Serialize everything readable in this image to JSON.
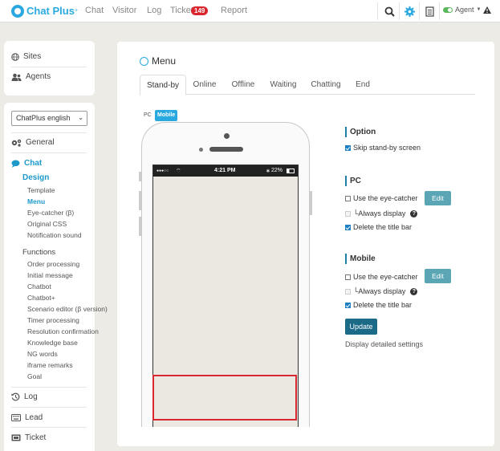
{
  "app": {
    "logo_text": "Chat Plus",
    "logo_sup": "+"
  },
  "topnav": {
    "items": [
      "Chat",
      "Visitor",
      "Log",
      "Ticket",
      "Report"
    ],
    "ticket_badge": "149",
    "agent_label": "Agent"
  },
  "sidebar": {
    "top_items": [
      "Sites",
      "Agents"
    ],
    "site_select": "ChatPlus english",
    "general": "General",
    "chat": "Chat",
    "design_header": "Design",
    "design_items": [
      "Template",
      "Menu",
      "Eye-catcher (β)",
      "Original CSS",
      "Notification sound"
    ],
    "functions_header": "Functions",
    "function_items": [
      "Order processing",
      "Initial message",
      "Chatbot",
      "Chatbot+",
      "Scenario editor (β version)",
      "Timer processing",
      "Resolution confirmation",
      "Knowledge base",
      "NG words",
      "iframe remarks",
      "Goal"
    ],
    "bottom_items": [
      "Log",
      "Lead",
      "Ticket"
    ]
  },
  "main": {
    "title": "Menu",
    "tabs": [
      "Stand-by",
      "Online",
      "Offline",
      "Waiting",
      "Chatting",
      "End"
    ],
    "active_tab": "Stand-by",
    "device_tabs": [
      "PC",
      "Mobile"
    ],
    "phone_status": {
      "left": "●●●○○",
      "time": "4:21 PM",
      "battery": "22%"
    }
  },
  "settings": {
    "option_header": "Option",
    "skip_standby": "Skip stand-by screen",
    "pc_header": "PC",
    "mobile_header": "Mobile",
    "use_eye_catcher": "Use the eye-catcher",
    "edit_label": "Edit",
    "always_display": "└Always display",
    "delete_title_bar": "Delete the title bar",
    "update_label": "Update",
    "detail_link": "Display detailed settings"
  },
  "colors": {
    "accent": "#29a9df",
    "highlight": "#d9262f",
    "primary_button": "#1b6a87"
  }
}
